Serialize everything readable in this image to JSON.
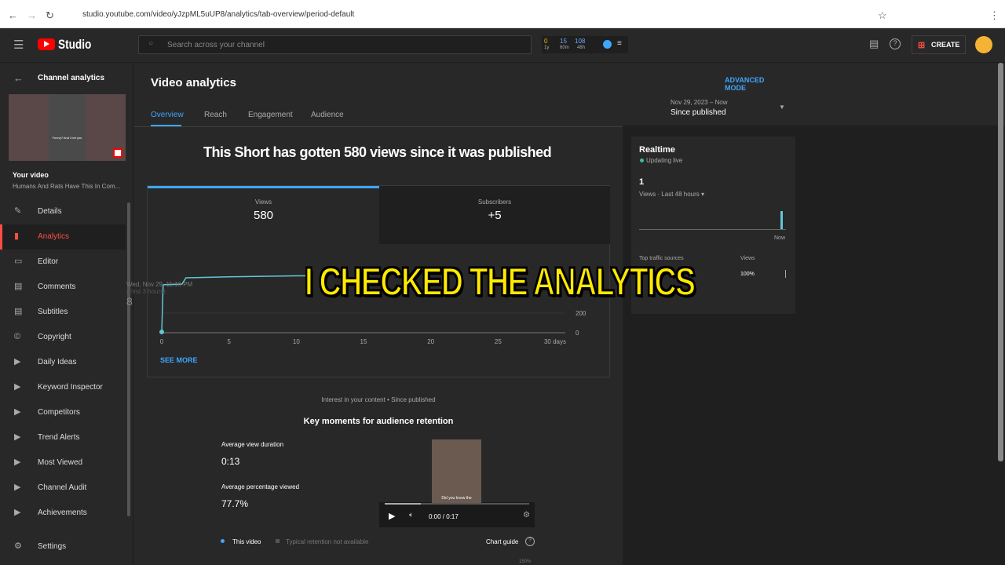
{
  "browser": {
    "url": "studio.youtube.com/video/yJzpML5uUP8/analytics/tab-overview/period-default"
  },
  "topbar": {
    "logo": "Studio",
    "search_placeholder": "Search across your channel",
    "stats": [
      {
        "value": "0",
        "label": "1y",
        "color": "#f2b600"
      },
      {
        "value": "15",
        "label": "60m",
        "color": "#6fa8ff"
      },
      {
        "value": "108",
        "label": "48h",
        "color": "#6fa8ff"
      }
    ],
    "create_label": "CREATE"
  },
  "sidebar": {
    "header": "Channel analytics",
    "your_video": "Your video",
    "video_title": "Humans And Rats Have This In Com...",
    "thumb_caption": "Funny? And I bet you",
    "items": [
      {
        "label": "Details",
        "icon": "pencil-icon"
      },
      {
        "label": "Analytics",
        "icon": "analytics-icon",
        "active": true
      },
      {
        "label": "Editor",
        "icon": "film-icon"
      },
      {
        "label": "Comments",
        "icon": "comment-icon"
      },
      {
        "label": "Subtitles",
        "icon": "subtitles-icon"
      },
      {
        "label": "Copyright",
        "icon": "copyright-icon"
      },
      {
        "label": "Daily Ideas",
        "icon": "play-circle-icon"
      },
      {
        "label": "Keyword Inspector",
        "icon": "play-circle-icon"
      },
      {
        "label": "Competitors",
        "icon": "play-circle-icon"
      },
      {
        "label": "Trend Alerts",
        "icon": "play-circle-icon"
      },
      {
        "label": "Most Viewed",
        "icon": "play-circle-icon"
      },
      {
        "label": "Channel Audit",
        "icon": "play-circle-icon"
      },
      {
        "label": "Achievements",
        "icon": "play-circle-icon"
      }
    ],
    "settings": "Settings"
  },
  "main": {
    "title": "Video analytics",
    "advanced_mode": "ADVANCED MODE",
    "tabs": [
      "Overview",
      "Reach",
      "Engagement",
      "Audience"
    ],
    "period": {
      "range": "Nov 29, 2023 – Now",
      "label": "Since published"
    },
    "headline": "This Short has gotten 580 views since it was published",
    "metrics": [
      {
        "label": "Views",
        "value": "580"
      },
      {
        "label": "Subscribers",
        "value": "+5"
      }
    ],
    "see_more": "SEE MORE",
    "tooltip": {
      "date": "Wed, Nov 29, 11:16 PM",
      "period": "(First 3 hours)",
      "value": "8"
    },
    "interest": "Interest in your content • Since published",
    "retention_title": "Key moments for audience retention",
    "avg_duration_label": "Average view duration",
    "avg_duration": "0:13",
    "avg_pct_label": "Average percentage viewed",
    "avg_pct": "77.7%",
    "player": {
      "caption": "Did you know the",
      "time": "0:00 / 0:17",
      "progress": 0.25
    },
    "legend_this": "This video",
    "legend_typical": "Typical retention not available",
    "chart_guide": "Chart guide",
    "retention_tick": "150%"
  },
  "chart_data": {
    "type": "line",
    "x_ticks": [
      "0",
      "5",
      "10",
      "15",
      "20",
      "25",
      "30 days"
    ],
    "y_ticks": [
      "0",
      "200"
    ],
    "xlim": [
      0,
      30
    ],
    "color": "#3ea6ff",
    "x": [
      0,
      0.1,
      0.15,
      1.5,
      1.8,
      5,
      10,
      11
    ],
    "y": [
      8,
      480,
      490,
      495,
      560,
      570,
      580,
      580
    ]
  },
  "realtime": {
    "title": "Realtime",
    "status": "Updating live",
    "value": "1",
    "period": "Views · Last 48 hours",
    "now": "Now",
    "traffic_label": "Top traffic sources",
    "views_label": "Views",
    "traffic_pct": "100%"
  },
  "overlay_caption": "I CHECKED THE ANALYTICS"
}
